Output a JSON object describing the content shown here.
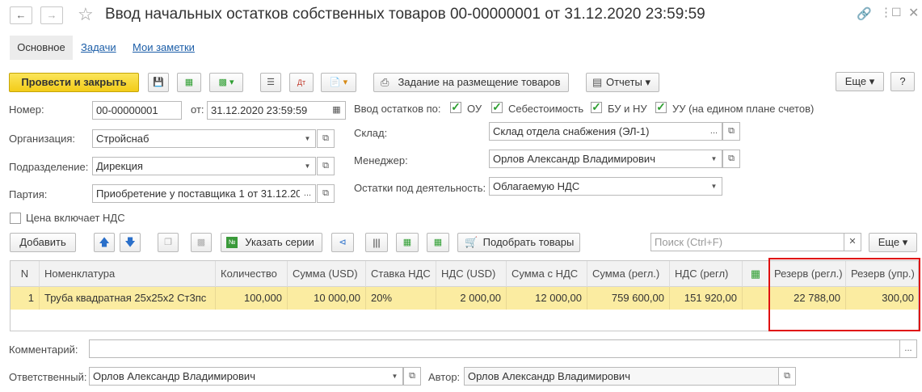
{
  "window": {
    "title": "Ввод начальных остатков собственных товаров 00-00000001 от 31.12.2020 23:59:59"
  },
  "tabs": [
    "Основное",
    "Задачи",
    "Мои заметки"
  ],
  "toolbar": {
    "post_close": "Провести и закрыть",
    "placement_task": "Задание на размещение товаров",
    "reports": "Отчеты",
    "more": "Еще",
    "help": "?"
  },
  "form": {
    "number_label": "Номер:",
    "number_value": "00-00000001",
    "date_label": "от:",
    "date_value": "31.12.2020 23:59:59",
    "org_label": "Организация:",
    "org_value": "Стройснаб",
    "dept_label": "Подразделение:",
    "dept_value": "Дирекция",
    "batch_label": "Партия:",
    "batch_value": "Приобретение у поставщика 1 от 31.12.20",
    "vat_included_label": "Цена включает НДС",
    "balance_input_label": "Ввод остатков по:",
    "chk_ou": "ОУ",
    "chk_cost": "Себестоимость",
    "chk_bu": "БУ и НУ",
    "chk_uu": "УУ (на едином плане счетов)",
    "warehouse_label": "Склад:",
    "warehouse_value": "Склад отдела снабжения (ЭЛ-1)",
    "manager_label": "Менеджер:",
    "manager_value": "Орлов Александр Владимирович",
    "activity_label": "Остатки под деятельность:",
    "activity_value": "Облагаемую НДС",
    "comment_label": "Комментарий:",
    "comment_value": "",
    "responsible_label": "Ответственный:",
    "responsible_value": "Орлов Александр Владимирович",
    "author_label": "Автор:",
    "author_value": "Орлов Александр Владимирович"
  },
  "table_toolbar": {
    "add": "Добавить",
    "series": "Указать серии",
    "pick_goods": "Подобрать товары",
    "search_placeholder": "Поиск (Ctrl+F)",
    "more": "Еще"
  },
  "table": {
    "columns": [
      "N",
      "Номенклатура",
      "Количество",
      "Сумма (USD)",
      "Ставка НДС",
      "НДС (USD)",
      "Сумма с НДС",
      "Сумма (регл.)",
      "НДС (регл)",
      "",
      "Резерв (регл.)",
      "Резерв (упр.)"
    ],
    "rows": [
      [
        "1",
        "Труба квадратная 25х25х2 Ст3пс",
        "100,000",
        "10 000,00",
        "20%",
        "2 000,00",
        "12 000,00",
        "759 600,00",
        "151 920,00",
        "",
        "22 788,00",
        "300,00"
      ]
    ]
  },
  "colors": {
    "accent_yellow": "#f3cc19",
    "row_highlight": "#fbeca1",
    "link_blue": "#1c5ea8",
    "highlight_box": "#e01010",
    "check_green": "#2e9e31"
  }
}
